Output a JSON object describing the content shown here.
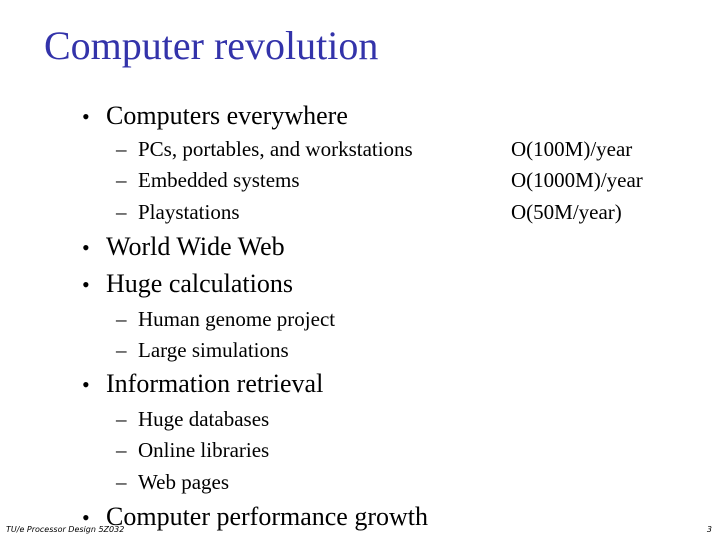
{
  "slide": {
    "title": "Computer revolution",
    "title_color": "#3333aa",
    "bullet_glyph": "•",
    "dash_glyph": "–",
    "items": [
      {
        "label": "Computers everywhere",
        "subitems": [
          {
            "label": "PCs, portables, and workstations",
            "rate": "O(100M)/year"
          },
          {
            "label": "Embedded systems",
            "rate": "O(1000M)/year"
          },
          {
            "label": "Playstations",
            "rate": "O(50M/year)"
          }
        ]
      },
      {
        "label": "World Wide Web",
        "subitems": []
      },
      {
        "label": "Huge calculations",
        "subitems": [
          {
            "label": "Human genome project"
          },
          {
            "label": "Large simulations"
          }
        ]
      },
      {
        "label": "Information retrieval",
        "subitems": [
          {
            "label": "Huge databases"
          },
          {
            "label": "Online libraries"
          },
          {
            "label": "Web pages"
          }
        ]
      },
      {
        "label": "Computer performance growth",
        "subitems": []
      }
    ]
  },
  "footer": {
    "course": "TU/e   Processor Design 5Z032",
    "page_number": "3"
  }
}
